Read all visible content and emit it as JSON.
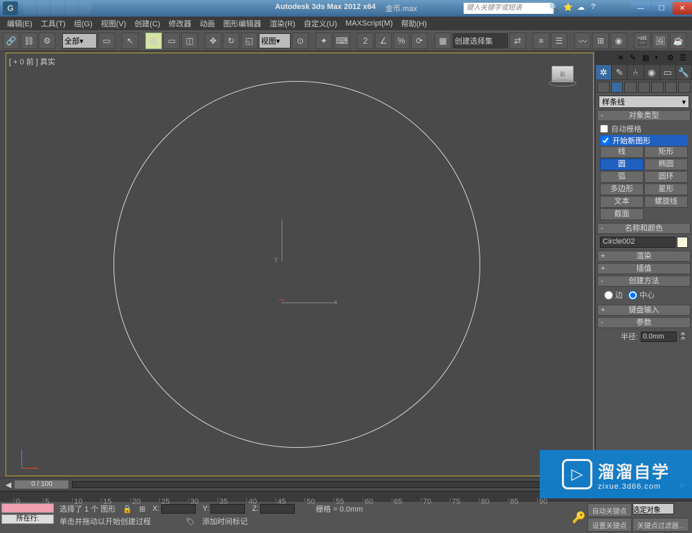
{
  "title": {
    "product": "Autodesk 3ds Max  2012 x64",
    "file": "金币.max",
    "search_placeholder": "键入关键字或短语"
  },
  "menus": [
    {
      "label": "编辑(E)"
    },
    {
      "label": "工具(T)"
    },
    {
      "label": "组(G)"
    },
    {
      "label": "视图(V)"
    },
    {
      "label": "创建(C)"
    },
    {
      "label": "修改器"
    },
    {
      "label": "动画"
    },
    {
      "label": "图形编辑器"
    },
    {
      "label": "渲染(R)"
    },
    {
      "label": "自定义(U)"
    },
    {
      "label": "MAXScript(M)"
    },
    {
      "label": "帮助(H)"
    }
  ],
  "toolbar": {
    "scope_label": "全部",
    "scope_arrow": "▾",
    "view_label": "视图",
    "view_arrow": "▾",
    "selset_label": "创建选择集"
  },
  "viewport": {
    "label": "[ + 0 前 ] 真实",
    "cube_face": "前",
    "axis_y": "y",
    "axis_x": "x"
  },
  "panel": {
    "category": "样条线",
    "category_arrow": "▾",
    "rollout_objtype": "对象类型",
    "autogrid": "自动栅格",
    "startnew": "开始新图形",
    "buttons": [
      [
        "线",
        "矩形"
      ],
      [
        "圆",
        "椭圆"
      ],
      [
        "弧",
        "圆环"
      ],
      [
        "多边形",
        "星形"
      ],
      [
        "文本",
        "螺旋线"
      ],
      [
        "截面",
        ""
      ]
    ],
    "active_button": "圆",
    "rollout_name": "名称和颜色",
    "object_name": "Circle002",
    "rollout_render": "渲染",
    "rollout_interp": "插值",
    "rollout_method": "创建方法",
    "method_edge": "边",
    "method_center": "中心",
    "rollout_keyboard": "键盘输入",
    "rollout_params": "参数",
    "radius_label": "半径:",
    "radius_value": "0.0mm"
  },
  "timeline": {
    "slider": "0 / 100",
    "ticks": [
      0,
      5,
      10,
      15,
      20,
      25,
      30,
      35,
      40,
      45,
      50,
      55,
      60,
      65,
      70,
      75,
      80,
      85,
      90
    ]
  },
  "status": {
    "location": "所在行:",
    "selection": "选择了 1 个 图形",
    "prompt": "单击并拖动以开始创建过程",
    "addtime": "添加时间标记",
    "grid": "栅格 = 0.0mm",
    "autokey": "自动关键点",
    "selkey": "选定对象",
    "setkey": "设置关键点",
    "keyfilter": "关键点过滤器...",
    "x": "X:",
    "y": "Y:",
    "z": "Z:"
  },
  "watermark": {
    "icon": "▷",
    "big": "溜溜自学",
    "small": "zixue.3d66.com"
  }
}
